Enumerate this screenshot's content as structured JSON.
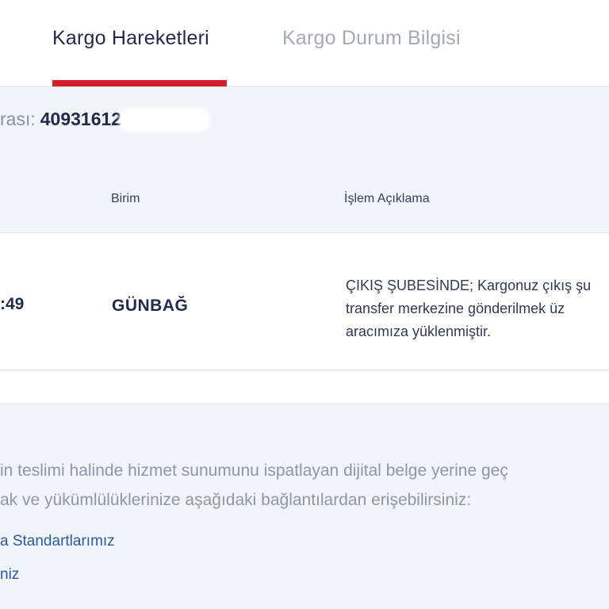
{
  "tabs": [
    {
      "label": "Kargo Hareketleri",
      "active": true
    },
    {
      "label": "Kargo Durum Bilgisi",
      "active": false
    }
  ],
  "tracking": {
    "label_fragment": "rası:",
    "number_fragment": "40931612"
  },
  "table": {
    "headers": {
      "unit": "Birim",
      "description": "İşlem Açıklama"
    },
    "rows": [
      {
        "time_fragment": ":49",
        "unit": "GÜNBAĞ",
        "description_lines": [
          "ÇIKIŞ ŞUBESİNDE; Kargonuz çıkış şu",
          "transfer merkezine gönderilmek üz",
          "aracımıza yüklenmiştir."
        ]
      }
    ]
  },
  "info": {
    "lines": [
      "in teslimi halinde hizmet sunumunu ispatlayan dijital belge yerine geç",
      "ak ve yükümlülüklerinize aşağıdaki bağlantılardan erişebilirsiniz:"
    ],
    "links": [
      "a Standartlarımız",
      "niz"
    ]
  },
  "colors": {
    "accent": "#d41d2a",
    "text_dark": "#1f2b48",
    "muted": "#a3a9b6",
    "link": "#2d5a9e",
    "page_bg": "#f0f4fb"
  }
}
